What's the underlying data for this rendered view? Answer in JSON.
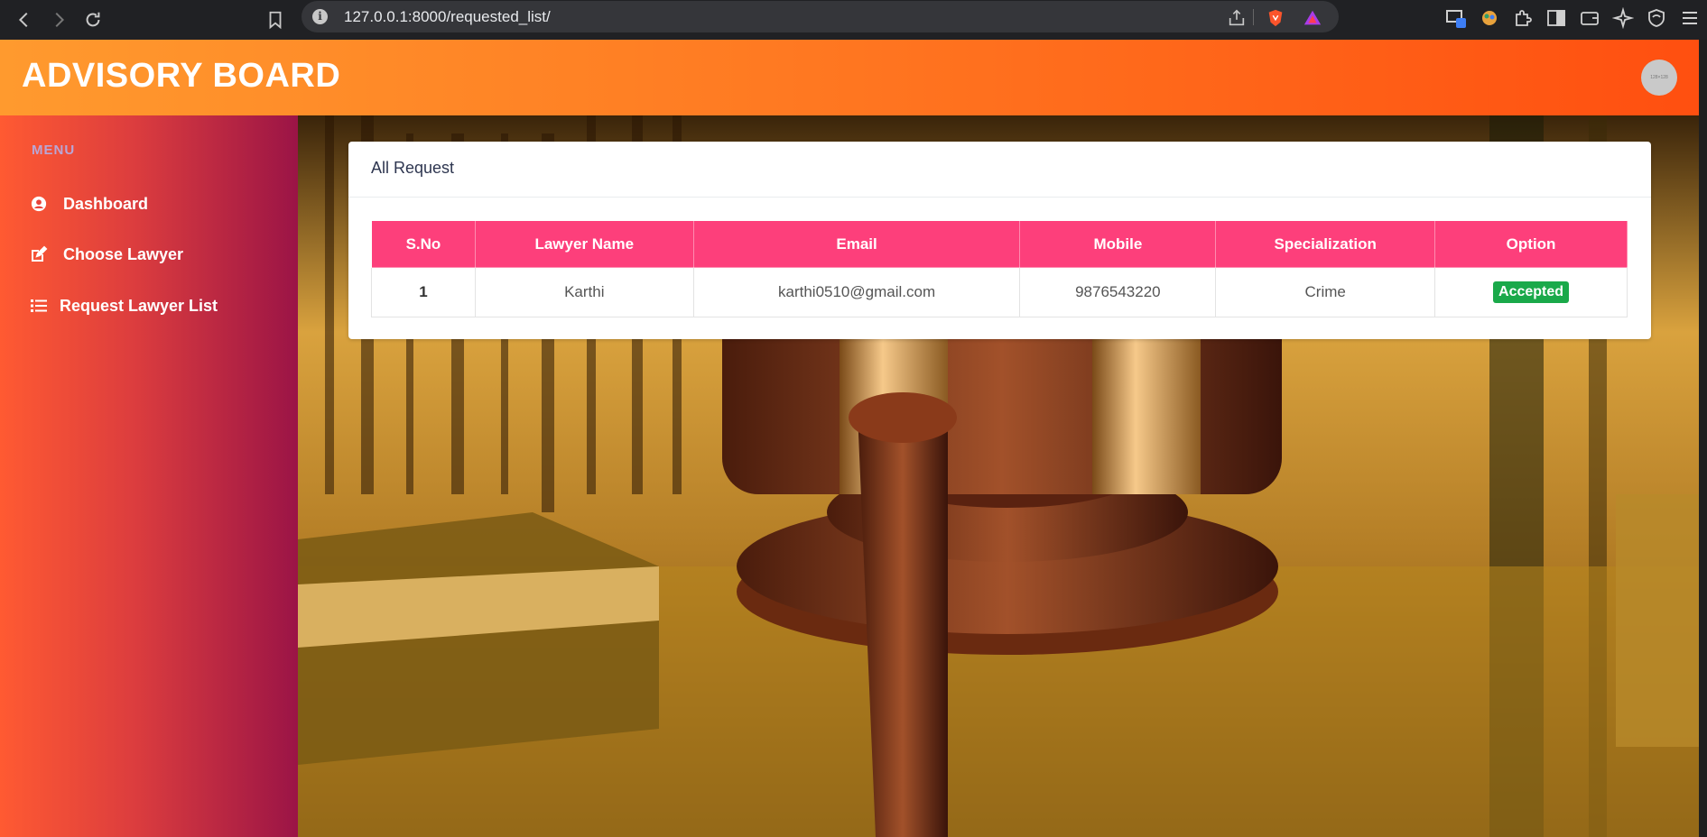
{
  "browser": {
    "url": "127.0.0.1:8000/requested_list/"
  },
  "header": {
    "brand": "ADVISORY BOARD",
    "avatar_text": "128×128"
  },
  "sidebar": {
    "menu_title": "MENU",
    "items": [
      {
        "label": "Dashboard",
        "icon": "user-circle-icon"
      },
      {
        "label": "Choose Lawyer",
        "icon": "edit-icon"
      },
      {
        "label": "Request Lawyer List",
        "icon": "list-icon"
      }
    ]
  },
  "main": {
    "card_title": "All Request",
    "table": {
      "columns": [
        "S.No",
        "Lawyer Name",
        "Email",
        "Mobile",
        "Specialization",
        "Option"
      ],
      "rows": [
        {
          "sno": "1",
          "name": "Karthi",
          "email": "karthi0510@gmail.com",
          "mobile": "9876543220",
          "specialization": "Crime",
          "option": "Accepted"
        }
      ]
    }
  },
  "colors": {
    "header_accent": "#ff7a22",
    "table_header": "#fd3f7b",
    "status_accepted": "#1aa94a"
  }
}
